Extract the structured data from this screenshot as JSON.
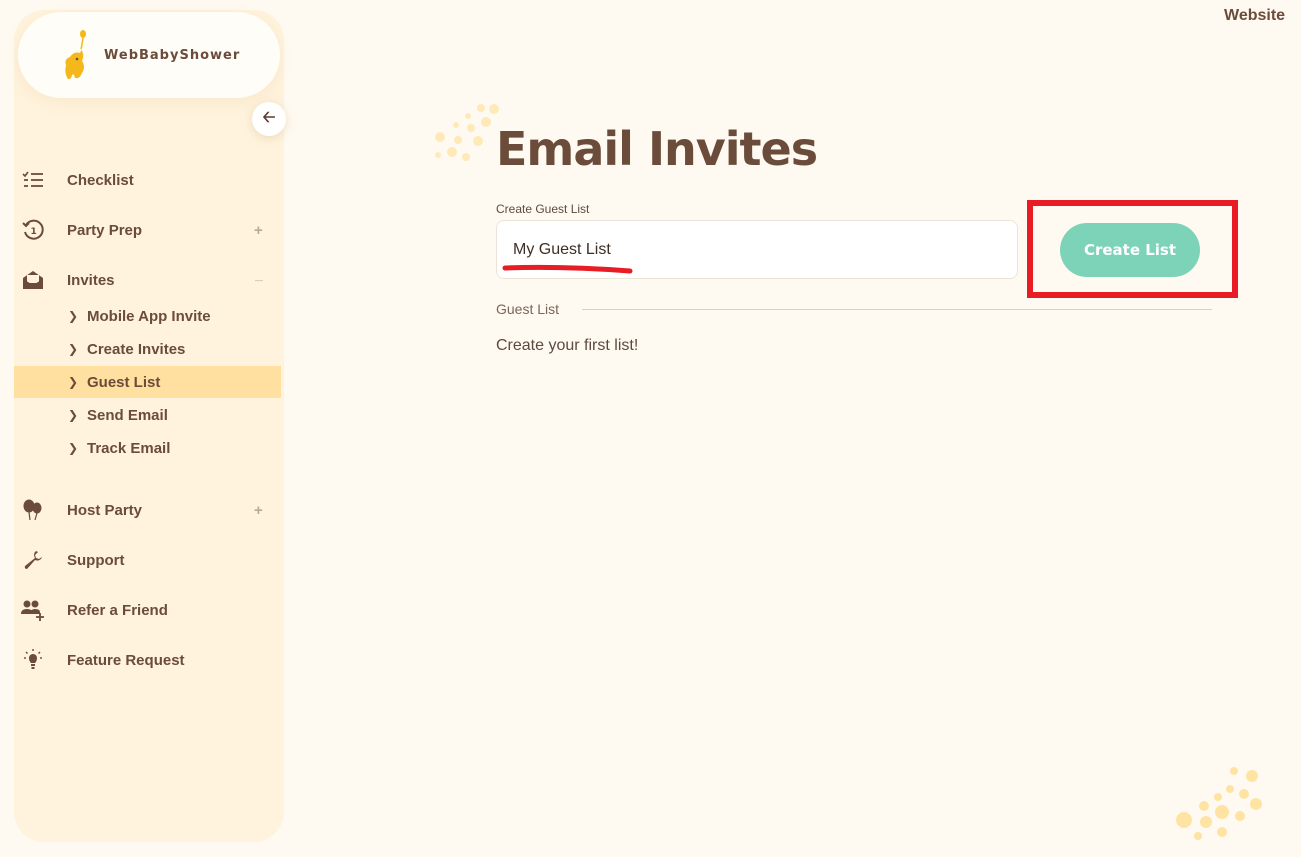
{
  "brand": {
    "name": "WebBabyShower"
  },
  "header": {
    "website_link": "Website"
  },
  "sidebar": {
    "collapse_icon": "arrow-left-icon",
    "items": [
      {
        "label": "Checklist",
        "icon": "checklist-icon"
      },
      {
        "label": "Party Prep",
        "icon": "history-icon",
        "expander": "+"
      },
      {
        "label": "Invites",
        "icon": "envelope-open-icon",
        "expander": "—",
        "children": [
          {
            "label": "Mobile App Invite"
          },
          {
            "label": "Create Invites"
          },
          {
            "label": "Guest List",
            "active": true
          },
          {
            "label": "Send Email"
          },
          {
            "label": "Track Email"
          }
        ]
      },
      {
        "label": "Host Party",
        "icon": "balloons-icon",
        "expander": "+"
      },
      {
        "label": "Support",
        "icon": "wrench-icon"
      },
      {
        "label": "Refer a Friend",
        "icon": "add-user-icon"
      },
      {
        "label": "Feature Request",
        "icon": "lightbulb-icon"
      }
    ]
  },
  "main": {
    "title": "Email Invites",
    "create_field": {
      "label": "Create Guest List",
      "value": "My Guest List"
    },
    "create_button": "Create List",
    "guest_list_label": "Guest List",
    "empty_message": "Create your first list!"
  },
  "colors": {
    "background": "#fffaf1",
    "sidebar": "#fff3dd",
    "active_item": "#ffe0a0",
    "text": "#6b4c3b",
    "button": "#7dd3b8",
    "annotation_red": "#e81c24",
    "dots": "#ffe3a3"
  }
}
